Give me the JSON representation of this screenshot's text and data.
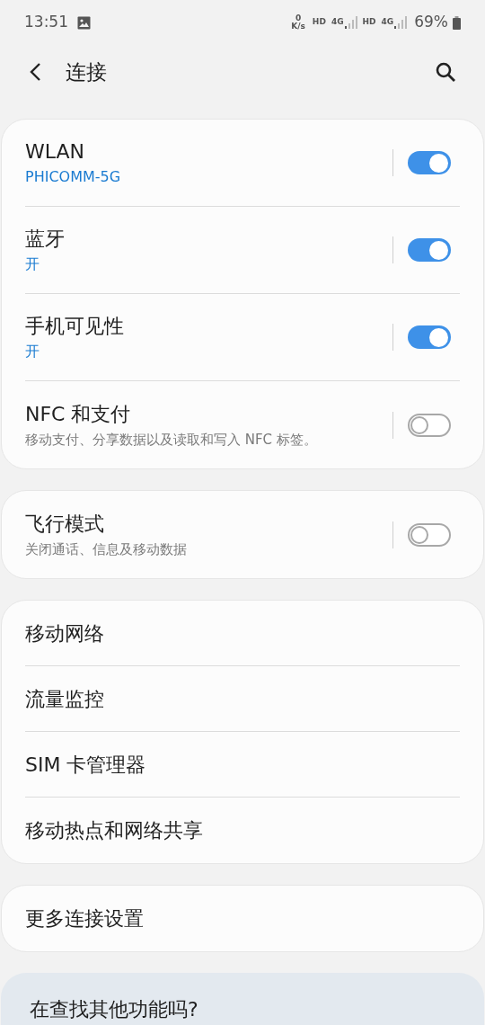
{
  "status_bar": {
    "time": "13:51",
    "net_speed": {
      "value": "0",
      "unit": "K/s"
    },
    "network_labels": [
      "HD",
      "4G",
      "HD",
      "4G"
    ],
    "battery": "69%"
  },
  "header": {
    "title": "连接"
  },
  "groups": [
    {
      "items": [
        {
          "kind": "toggle",
          "title": "WLAN",
          "subtitle": {
            "text": "PHICOMM-5G",
            "kind": "status"
          },
          "on": true
        },
        {
          "kind": "toggle",
          "title": "蓝牙",
          "subtitle": {
            "text": "开",
            "kind": "status"
          },
          "on": true
        },
        {
          "kind": "toggle",
          "title": "手机可见性",
          "subtitle": {
            "text": "开",
            "kind": "status"
          },
          "on": true
        },
        {
          "kind": "toggle",
          "title": "NFC 和支付",
          "subtitle": {
            "text": "移动支付、分享数据以及读取和写入 NFC 标签。",
            "kind": "hint"
          },
          "on": false
        }
      ]
    },
    {
      "items": [
        {
          "kind": "toggle",
          "title": "飞行模式",
          "subtitle": {
            "text": "关闭通话、信息及移动数据",
            "kind": "hint"
          },
          "on": false
        }
      ]
    },
    {
      "items": [
        {
          "kind": "link",
          "title": "移动网络"
        },
        {
          "kind": "link",
          "title": "流量监控"
        },
        {
          "kind": "link",
          "title": "SIM 卡管理器"
        },
        {
          "kind": "link",
          "title": "移动热点和网络共享"
        }
      ]
    },
    {
      "items": [
        {
          "kind": "link",
          "title": "更多连接设置"
        }
      ]
    }
  ],
  "suggestion": {
    "title": "在查找其他功能吗?"
  }
}
